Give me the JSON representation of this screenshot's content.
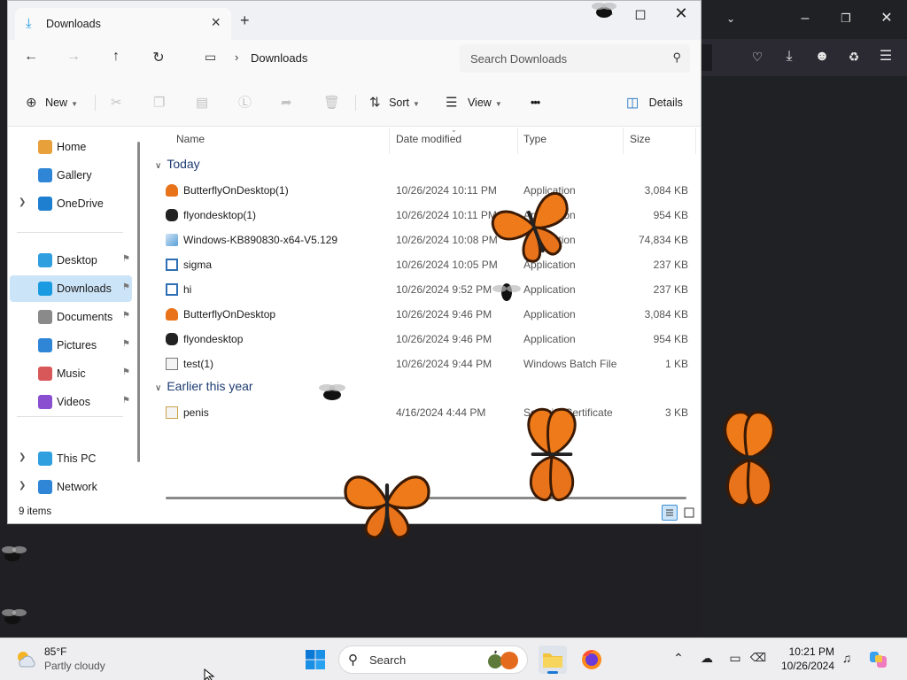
{
  "explorer": {
    "tab_title": "Downloads",
    "window_controls": [
      "minimize",
      "maximize",
      "close"
    ],
    "breadcrumb": "Downloads",
    "search_placeholder": "Search Downloads",
    "commands": {
      "new": "New",
      "sort": "Sort",
      "view": "View",
      "more": "•••",
      "details": "Details"
    },
    "sidebar": [
      {
        "label": "Home",
        "icon": "home-icon",
        "color": "#e8a13a"
      },
      {
        "label": "Gallery",
        "icon": "gallery-icon",
        "color": "#2f86d6"
      },
      {
        "label": "OneDrive",
        "icon": "cloud-icon",
        "color": "#1e7fd1",
        "expandable": true
      },
      {
        "label": "Desktop",
        "icon": "desktop-icon",
        "color": "#2f9fe0",
        "pinned": true
      },
      {
        "label": "Downloads",
        "icon": "download-icon",
        "color": "#1a9ae0",
        "pinned": true,
        "active": true
      },
      {
        "label": "Documents",
        "icon": "documents-icon",
        "color": "#8a8a8a",
        "pinned": true
      },
      {
        "label": "Pictures",
        "icon": "pictures-icon",
        "color": "#2f86d6",
        "pinned": true
      },
      {
        "label": "Music",
        "icon": "music-icon",
        "color": "#d8585a",
        "pinned": true
      },
      {
        "label": "Videos",
        "icon": "videos-icon",
        "color": "#8a4fd0",
        "pinned": true
      },
      {
        "label": "This PC",
        "icon": "pc-icon",
        "color": "#2f9fe0",
        "expandable": true
      },
      {
        "label": "Network",
        "icon": "network-icon",
        "color": "#2f86d6",
        "expandable": true
      }
    ],
    "columns": {
      "name": "Name",
      "date": "Date modified",
      "type": "Type",
      "size": "Size"
    },
    "groups": [
      {
        "label": "Today",
        "files": [
          {
            "name": "ButterflyOnDesktop(1)",
            "date": "10/26/2024 10:11 PM",
            "type": "Application",
            "size": "3,084 KB",
            "icon": "butterfly-app-icon"
          },
          {
            "name": "flyondesktop(1)",
            "date": "10/26/2024 10:11 PM",
            "type": "Application",
            "size": "954 KB",
            "icon": "fly-app-icon"
          },
          {
            "name": "Windows-KB890830-x64-V5.129",
            "date": "10/26/2024 10:08 PM",
            "type": "Application",
            "size": "74,834 KB",
            "icon": "installer-icon"
          },
          {
            "name": "sigma",
            "date": "10/26/2024 10:05 PM",
            "type": "Application",
            "size": "237 KB",
            "icon": "app-window-icon"
          },
          {
            "name": "hi",
            "date": "10/26/2024 9:52 PM",
            "type": "Application",
            "size": "237 KB",
            "icon": "app-window-icon"
          },
          {
            "name": "ButterflyOnDesktop",
            "date": "10/26/2024 9:46 PM",
            "type": "Application",
            "size": "3,084 KB",
            "icon": "butterfly-app-icon"
          },
          {
            "name": "flyondesktop",
            "date": "10/26/2024 9:46 PM",
            "type": "Application",
            "size": "954 KB",
            "icon": "fly-app-icon"
          },
          {
            "name": "test(1)",
            "date": "10/26/2024 9:44 PM",
            "type": "Windows Batch File",
            "size": "1 KB",
            "icon": "batch-file-icon"
          }
        ]
      },
      {
        "label": "Earlier this year",
        "files": [
          {
            "name": "penis",
            "date": "4/16/2024 4:44 PM",
            "type": "Security Certificate",
            "size": "3 KB",
            "icon": "certificate-icon"
          }
        ]
      }
    ],
    "status": "9 items"
  },
  "taskbar": {
    "weather_temp": "85°F",
    "weather_desc": "Partly cloudy",
    "search_label": "Search",
    "time": "10:21 PM",
    "date": "10/26/2024"
  },
  "colors": {
    "accent": "#1a9ae0",
    "selection": "#cce4f7",
    "butterfly": "#ef7a1a"
  }
}
